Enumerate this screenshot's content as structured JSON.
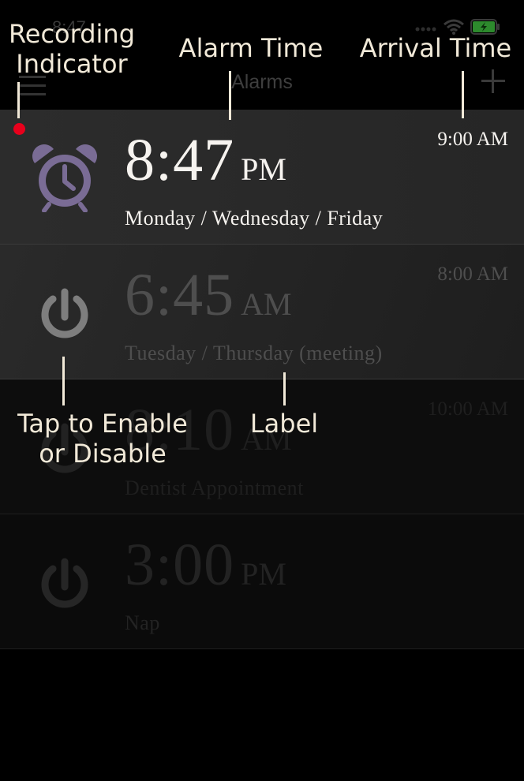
{
  "status_bar": {
    "time": "8:47",
    "battery_color": "#2d8a2d"
  },
  "nav": {
    "title": "Alarms"
  },
  "alarms": [
    {
      "time": "8:47",
      "ampm": "PM",
      "label": "Monday / Wednesday / Friday",
      "arrival": "9:00 AM",
      "enabled": true,
      "recording": true
    },
    {
      "time": "6:45",
      "ampm": "AM",
      "label": "Tuesday / Thursday (meeting)",
      "arrival": "8:00 AM",
      "enabled": false
    },
    {
      "time": "8:10",
      "ampm": "AM",
      "label": "Dentist Appointment",
      "arrival": "10:00 AM",
      "enabled": false
    },
    {
      "time": "3:00",
      "ampm": "PM",
      "label": "Nap",
      "arrival": "",
      "enabled": false
    }
  ],
  "annotations": {
    "recording_indicator": "Recording\nIndicator",
    "alarm_time": "Alarm Time",
    "arrival_time": "Arrival Time",
    "tap_toggle": "Tap to Enable\nor Disable",
    "label": "Label"
  },
  "colors": {
    "accent_purple": "#7a6c95",
    "recording_red": "#e8001c",
    "annotation": "#f1e9d8"
  },
  "icons": {
    "active_alarm": "alarm-clock-icon",
    "inactive_alarm": "power-icon",
    "menu": "menu-icon",
    "add": "plus-icon"
  }
}
